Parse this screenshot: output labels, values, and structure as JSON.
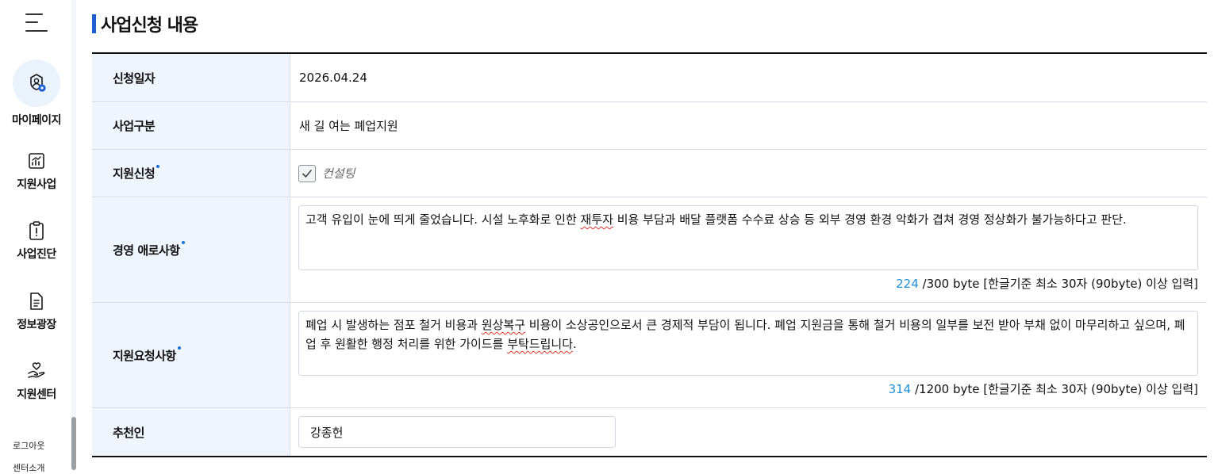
{
  "sidebar": {
    "items": [
      {
        "label": "마이페이지",
        "icon": "user-settings-icon",
        "active": true
      },
      {
        "label": "지원사업",
        "icon": "chart-icon",
        "active": false
      },
      {
        "label": "사업진단",
        "icon": "clipboard-alert-icon",
        "active": false
      },
      {
        "label": "정보광장",
        "icon": "document-icon",
        "active": false
      },
      {
        "label": "지원센터",
        "icon": "hand-heart-icon",
        "active": false
      }
    ],
    "sub_links": [
      "로그아웃",
      "센터소개"
    ]
  },
  "section": {
    "title": "사업신청 내용"
  },
  "form": {
    "apply_date": {
      "label": "신청일자",
      "value": "2026.04.24"
    },
    "business_type": {
      "label": "사업구분",
      "value": "새 길 여는 폐업지원"
    },
    "support_apply": {
      "label": "지원신청",
      "option": "컨설팅",
      "checked": true
    },
    "difficulties": {
      "label": "경영 애로사항",
      "text_a": "고객 유입이 눈에 띄게 줄었습니다. 시설 노후화로 인한 ",
      "text_b": "재투자",
      "text_c": " 비용 부담과 배달 플랫폼 수수료 상승 등 외부 경영 환경 악화가 겹쳐 경영 정상화가 불가능하다고 판단.",
      "count": "224",
      "limit_text": " /300 byte [한글기준 최소 30자 (90byte) 이상 입력]"
    },
    "request": {
      "label": "지원요청사항",
      "text_a": "폐업 시 발생하는 점포 철거 비용과 ",
      "text_b": "원상복구",
      "text_c": " 비용이 소상공인으로서 큰 경제적 부담이 됩니다. 폐업 지원금을 통해 철거 비용의 일부를 보전 받아 부채 없이 마무리하고 싶으며, 폐업 후 원활한 행정 처리를 위한 가이드를 ",
      "text_d": "부탁드립니다",
      "text_e": ".",
      "count": "314",
      "limit_text": " /1200 byte [한글기준 최소 30자 (90byte) 이상 입력]"
    },
    "recommender": {
      "label": "추천인",
      "value": "강종헌"
    }
  }
}
